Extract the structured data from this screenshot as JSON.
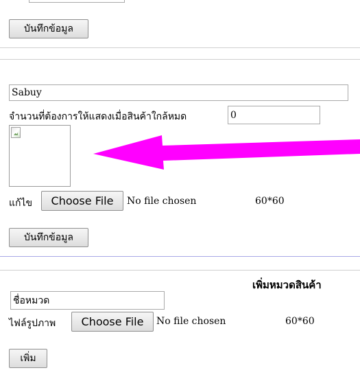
{
  "top_section": {
    "save_button_label": "บันทึกข้อมูล"
  },
  "brand_section": {
    "name_value": "Sabuy",
    "low_stock_label": "จำนวนที่ต้องการให้แสดงเมื่อสินค้าใกล้หมด",
    "low_stock_value": "0",
    "edit_label": "แก้ไข",
    "choose_file_label": "Choose File",
    "no_file_text": "No file chosen",
    "size_hint": "60*60",
    "save_button_label": "บันทึกข้อมูล"
  },
  "add_category": {
    "heading": "เพิ่มหมวดสินค้า",
    "name_placeholder": "ชื่อหมวด",
    "image_file_label": "ไฟล์รูปภาพ",
    "choose_file_label": "Choose File",
    "no_file_text": "No file chosen",
    "size_hint": "60*60",
    "add_button_label": "เพิ่ม"
  },
  "colors": {
    "arrow": "#ff00ff",
    "divider_accent": "#a7a7e6"
  }
}
